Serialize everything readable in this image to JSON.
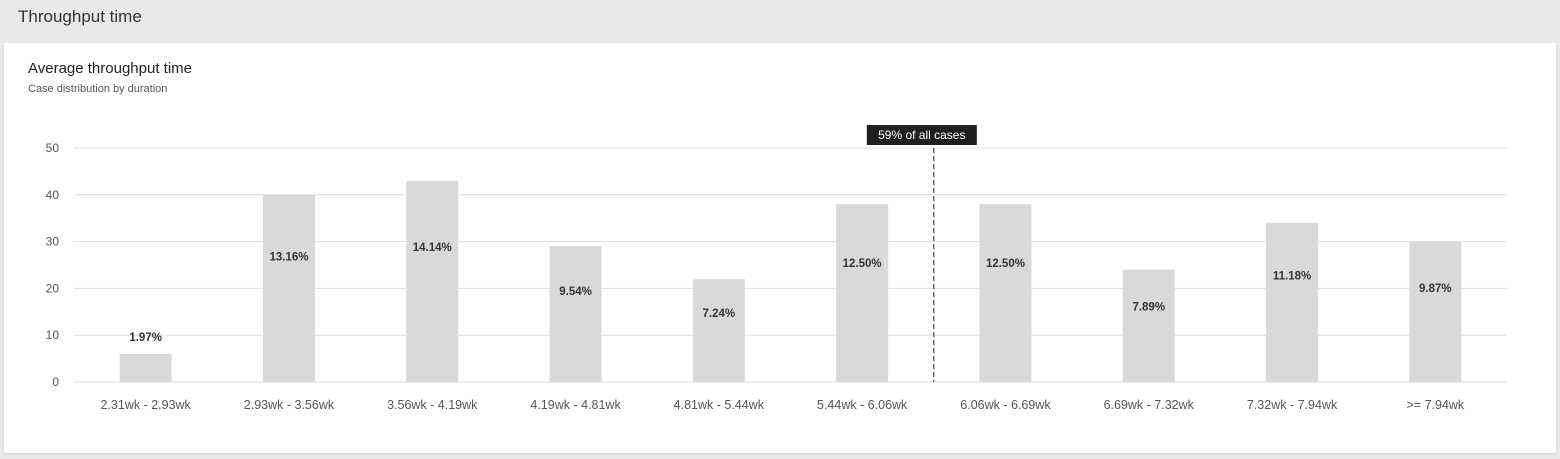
{
  "header": {
    "title": "Throughput time"
  },
  "card": {
    "title": "Average throughput time",
    "subtitle": "Case distribution by duration"
  },
  "colors": {
    "bar": "#d9d9d9",
    "grid": "#dedede",
    "marker_bg": "#1f1f1f"
  },
  "chart_data": {
    "type": "bar",
    "title": "Average throughput time",
    "subtitle": "Case distribution by duration",
    "xlabel": "",
    "ylabel": "",
    "ylim": [
      0,
      50
    ],
    "yticks": [
      0,
      10,
      20,
      30,
      40,
      50
    ],
    "grid": true,
    "categories": [
      "2.31wk - 2.93wk",
      "2.93wk - 3.56wk",
      "3.56wk - 4.19wk",
      "4.19wk - 4.81wk",
      "4.81wk - 5.44wk",
      "5.44wk - 6.06wk",
      "6.06wk - 6.69wk",
      "6.69wk - 7.32wk",
      "7.32wk - 7.94wk",
      ">= 7.94wk"
    ],
    "values": [
      6,
      40,
      43,
      29,
      22,
      38,
      38,
      24,
      34,
      30
    ],
    "data_labels": [
      "1.97%",
      "13.16%",
      "14.14%",
      "9.54%",
      "7.24%",
      "12.50%",
      "12.50%",
      "7.89%",
      "11.18%",
      "9.87%"
    ],
    "marker": {
      "label": "59% of all cases",
      "after_category_index": 5
    }
  }
}
